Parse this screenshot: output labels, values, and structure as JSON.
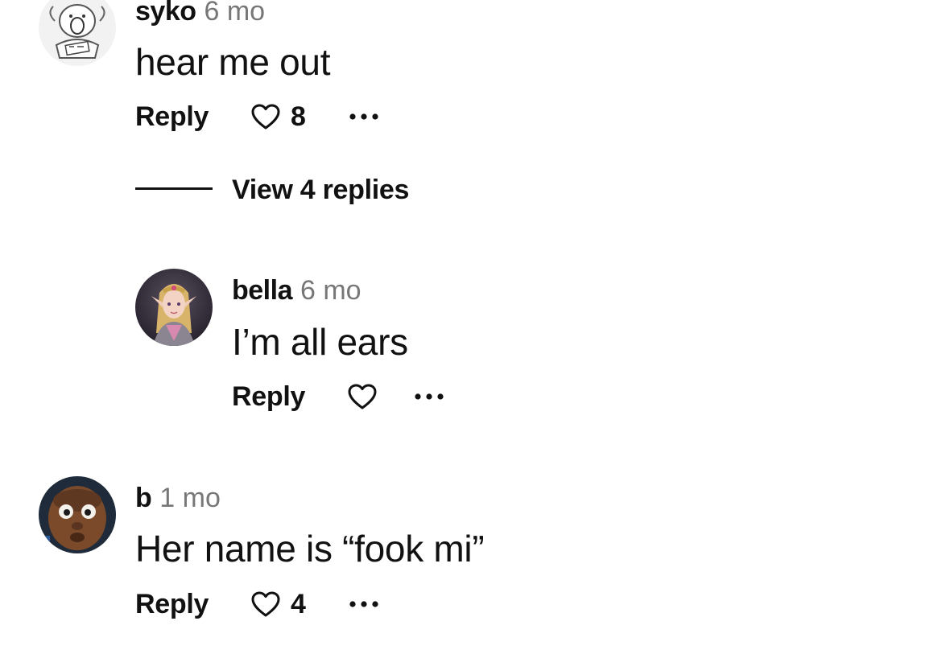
{
  "comments": [
    {
      "user": "syko",
      "time": "6 mo",
      "text": "hear me out",
      "reply_label": "Reply",
      "likes": "8",
      "avatar": "cartoon-sketch-avatar"
    },
    {
      "user": "bella",
      "time": "6 mo",
      "text": "I’m all ears",
      "reply_label": "Reply",
      "likes": "",
      "avatar": "elf-princess-avatar"
    },
    {
      "user": "b",
      "time": "1 mo",
      "text": "Her name is “fook mi”",
      "reply_label": "Reply",
      "likes": "4",
      "avatar": "wide-eyed-man-avatar"
    }
  ],
  "view_replies_label": "View 4 replies",
  "icons": {
    "like": "heart-outline-icon",
    "more": "more-options-icon"
  }
}
